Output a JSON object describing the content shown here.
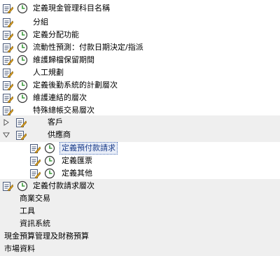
{
  "tree": {
    "items": [
      {
        "label": "定義現金管理科目名稱",
        "doc": true,
        "clock": true
      },
      {
        "label": "分組",
        "doc": true,
        "clock": false
      },
      {
        "label": "定義分配功能",
        "doc": true,
        "clock": true
      },
      {
        "label": "流動性預測：付款日期決定/指派",
        "doc": true,
        "clock": true
      },
      {
        "label": "維護歸檔保留期間",
        "doc": true,
        "clock": true
      },
      {
        "label": "人工規劃",
        "doc": true,
        "clock": false
      },
      {
        "label": "定義後勤系統的計劃層次",
        "doc": true,
        "clock": true
      },
      {
        "label": "維護連結的層次",
        "doc": true,
        "clock": true
      },
      {
        "label": "特殊總帳交易層次",
        "doc": true,
        "clock": false
      },
      {
        "label": "客戶",
        "doc": true,
        "clock": false,
        "expander": "collapsed"
      },
      {
        "label": "供應商",
        "doc": true,
        "clock": false,
        "expander": "expanded"
      },
      {
        "label": "定義預付款請求",
        "doc": true,
        "clock": true,
        "selected": true
      },
      {
        "label": "定義匯票",
        "doc": true,
        "clock": true
      },
      {
        "label": "定義其他",
        "doc": true,
        "clock": true
      },
      {
        "label": "定義付款請求層次",
        "doc": true,
        "clock": true
      },
      {
        "label": "商業交易",
        "doc": false,
        "clock": false
      },
      {
        "label": "工具",
        "doc": false,
        "clock": false
      },
      {
        "label": "資訊系統",
        "doc": false,
        "clock": false
      },
      {
        "label": "現金預算管理及財務預算",
        "doc": false,
        "clock": false
      },
      {
        "label": "市場資料",
        "doc": false,
        "clock": false
      }
    ]
  },
  "colors": {
    "band": "#efefef",
    "clock_green": "#3a9a3a",
    "selected_border": "#4a6fb5"
  },
  "icons": {
    "doc": "document-icon",
    "clock": "clock-icon",
    "collapsed": "triangle-right-icon",
    "expanded": "triangle-down-icon"
  }
}
